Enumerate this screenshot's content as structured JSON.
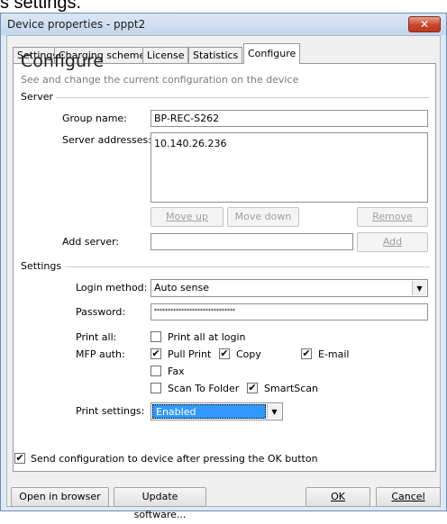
{
  "caption": "s settings.",
  "window": {
    "title": "Device properties - pppt2",
    "close_glyph": "✕"
  },
  "tabs": [
    {
      "label": "Settings",
      "active": false
    },
    {
      "label": "Charging scheme",
      "active": false
    },
    {
      "label": "License",
      "active": false
    },
    {
      "label": "Statistics",
      "active": false
    },
    {
      "label": "Configure",
      "active": true
    }
  ],
  "panel": {
    "heading": "Configure",
    "subtitle": "See and change the current configuration on the device"
  },
  "server": {
    "section_label": "Server",
    "group_name_label": "Group name:",
    "group_name_value": "BP-REC-S262",
    "addresses_label": "Server addresses:",
    "addresses": [
      "10.140.26.236"
    ],
    "move_up_label": "Move up",
    "move_down_label": "Move down",
    "remove_label": "Remove",
    "add_server_label": "Add server:",
    "add_server_value": "",
    "add_label": "Add"
  },
  "settings": {
    "section_label": "Settings",
    "login_method_label": "Login method:",
    "login_method_value": "Auto sense",
    "password_label": "Password:",
    "password_value": "******************************",
    "print_all_label": "Print all:",
    "print_all_at_login_label": "Print all at login",
    "print_all_at_login_checked": false,
    "mfp_auth_label": "MFP auth:",
    "mfp_options": [
      {
        "label": "Pull Print",
        "checked": true
      },
      {
        "label": "Copy",
        "checked": true
      },
      {
        "label": "E-mail",
        "checked": true
      },
      {
        "label": "Fax",
        "checked": false
      },
      {
        "label": "Scan To Folder",
        "checked": false
      },
      {
        "label": "SmartScan",
        "checked": true
      }
    ],
    "print_settings_label": "Print settings:",
    "print_settings_value": "Enabled"
  },
  "send_config": {
    "label": "Send configuration to device after pressing the OK button",
    "checked": true
  },
  "footer": {
    "open_browser_label": "Open in browser",
    "update_software_label": "Update software...",
    "ok_label": "OK",
    "cancel_label": "Cancel"
  },
  "glyphs": {
    "check": "✔",
    "dropdown": "▼"
  }
}
